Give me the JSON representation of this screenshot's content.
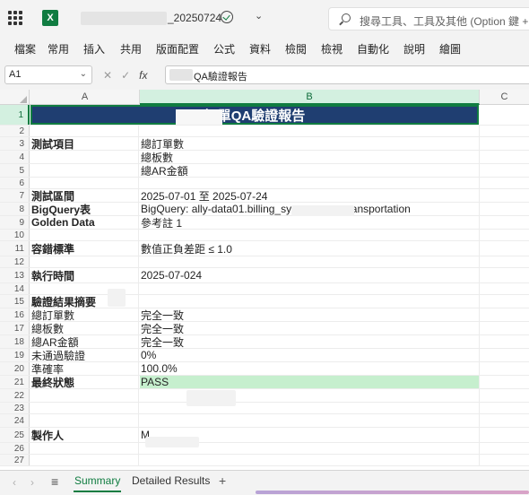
{
  "app": {
    "filename": "_20250724",
    "search_placeholder": "搜尋工具、工具及其他 (Option 鍵 + Q)"
  },
  "ribbon": {
    "tabs": [
      "檔案",
      "常用",
      "插入",
      "共用",
      "版面配置",
      "公式",
      "資料",
      "檢閱",
      "檢視",
      "自動化",
      "說明",
      "繪圖"
    ]
  },
  "formula_bar": {
    "name_box": "A1",
    "fx": "fx",
    "content": "QA驗證報告"
  },
  "grid": {
    "columns": [
      "A",
      "B",
      "C"
    ],
    "title_text": "訂單QA驗證報告",
    "rows": [
      {
        "n": "1",
        "a": "",
        "b": ""
      },
      {
        "n": "2",
        "a": "",
        "b": ""
      },
      {
        "n": "3",
        "a": "測試項目",
        "b": "總訂單數",
        "bold": true
      },
      {
        "n": "4",
        "a": "",
        "b": "總板數"
      },
      {
        "n": "5",
        "a": "",
        "b": "總AR金額"
      },
      {
        "n": "6",
        "a": "",
        "b": ""
      },
      {
        "n": "7",
        "a": "測試區間",
        "b": "2025-07-01 至 2025-07-24",
        "bold": true
      },
      {
        "n": "8",
        "a": "BigQuery表",
        "b": "BigQuery: ally-data01.billing_system_c          ar_transportation",
        "bold": true
      },
      {
        "n": "9",
        "a": "Golden Data",
        "b": "參考註 1",
        "bold": true
      },
      {
        "n": "10",
        "a": "",
        "b": ""
      },
      {
        "n": "11",
        "a": "容錯標準",
        "b": "數值正負差距 ≤ 1.0",
        "bold": true
      },
      {
        "n": "12",
        "a": "",
        "b": ""
      },
      {
        "n": "13",
        "a": "執行時間",
        "b": "2025-07-024",
        "bold": true
      },
      {
        "n": "14",
        "a": "",
        "b": ""
      },
      {
        "n": "15",
        "a": "驗證結果摘要",
        "b": "",
        "bold": true
      },
      {
        "n": "16",
        "a": "總訂單數",
        "b": "完全一致"
      },
      {
        "n": "17",
        "a": "總板數",
        "b": "完全一致"
      },
      {
        "n": "18",
        "a": "總AR金額",
        "b": "完全一致"
      },
      {
        "n": "19",
        "a": "未通過驗證",
        "b": "0%"
      },
      {
        "n": "20",
        "a": "準確率",
        "b": "100.0%"
      },
      {
        "n": "21",
        "a": "最終狀態",
        "b": "PASS",
        "bold": true,
        "pass": true
      },
      {
        "n": "22",
        "a": "",
        "b": ""
      },
      {
        "n": "23",
        "a": "",
        "b": ""
      },
      {
        "n": "24",
        "a": "",
        "b": ""
      },
      {
        "n": "25",
        "a": "製作人",
        "b": "M",
        "bold": true
      },
      {
        "n": "26",
        "a": "",
        "b": ""
      },
      {
        "n": "27",
        "a": "",
        "b": ""
      }
    ]
  },
  "sheets": {
    "active": "Summary",
    "other": "Detailed Results",
    "add": "+"
  },
  "colors": {
    "title_fill": "#1f3e71",
    "pass_fill": "#c6efce",
    "accent": "#107c41"
  }
}
